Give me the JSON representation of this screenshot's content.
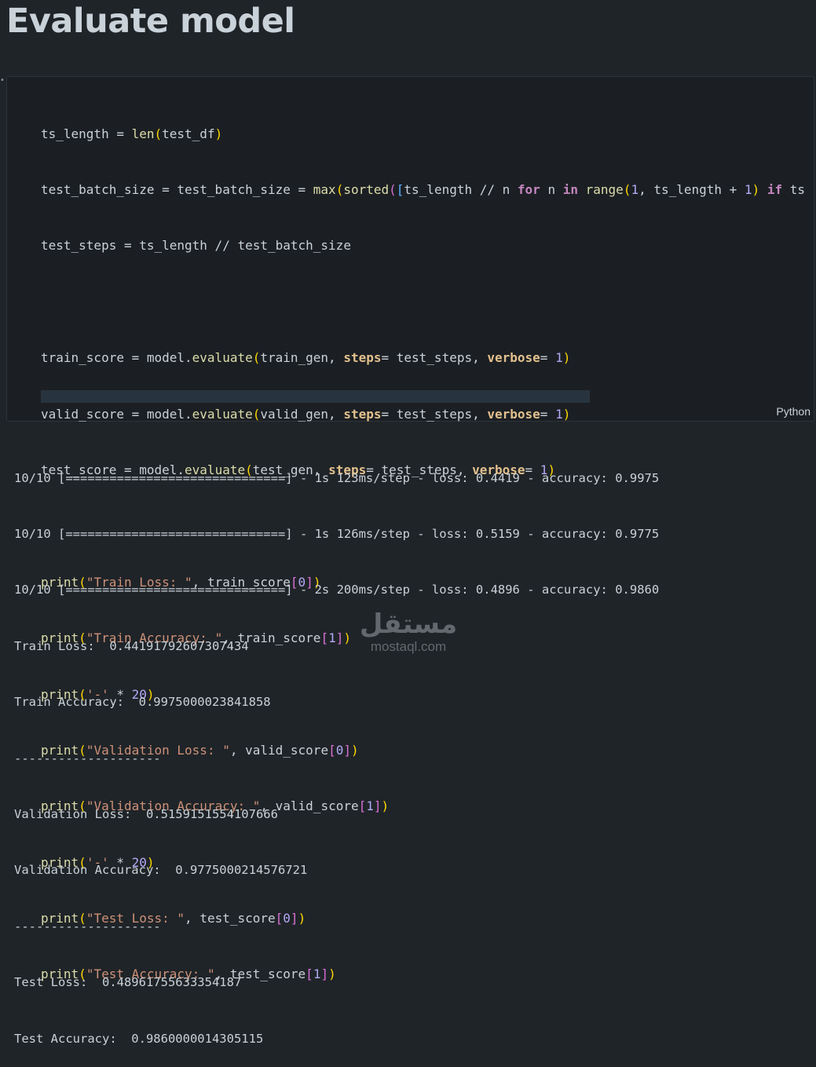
{
  "heading": "Evaluate model",
  "language_label": "Python",
  "code": {
    "l1": {
      "a": "ts_length = ",
      "b": "len",
      "c": "(",
      "d": "test_df",
      "e": ")"
    },
    "l2": {
      "a": "test_batch_size = test_batch_size = ",
      "b": "max",
      "c": "(",
      "d": "sorted",
      "e": "(",
      "f": "[",
      "g": "ts_length // n ",
      "h": "for",
      "i": " n ",
      "j": "in",
      "k": " ",
      "l": "range",
      "m": "(",
      "n": "1",
      ",": ", ts_length + ",
      "o": "1",
      "p": ")",
      "q": " ",
      "r": "if",
      "s": " ts"
    },
    "l3": {
      "a": "test_steps = ts_length // test_batch_size"
    },
    "l5": {
      "a": "train_score = model.",
      "b": "evaluate",
      "c": "(",
      "d": "train_gen, ",
      "e": "steps",
      "f": "= test_steps, ",
      "g": "verbose",
      "h": "= ",
      "i": "1",
      "j": ")"
    },
    "l6": {
      "a": "valid_score = model.",
      "b": "evaluate",
      "c": "(",
      "d": "valid_gen, ",
      "e": "steps",
      "f": "= test_steps, ",
      "g": "verbose",
      "h": "= ",
      "i": "1",
      "j": ")"
    },
    "l7": {
      "a": "test_score = model.",
      "b": "evaluate",
      "c": "(",
      "d": "test_gen, ",
      "e": "steps",
      "f": "= test_steps, ",
      "g": "verbose",
      "h": "= ",
      "i": "1",
      "j": ")"
    },
    "l9": {
      "a": "print",
      "b": "(",
      "c": "\"Train Loss: \"",
      "d": ", train_score",
      "e": "[",
      "f": "0",
      "g": "]",
      "h": ")"
    },
    "l10": {
      "a": "print",
      "b": "(",
      "c": "\"Train Accuracy: \"",
      "d": ", train_score",
      "e": "[",
      "f": "1",
      "g": "]",
      "h": ")"
    },
    "l11": {
      "a": "print",
      "b": "(",
      "c": "'-'",
      "d": " * ",
      "e": "20",
      "f": ")"
    },
    "l12": {
      "a": "print",
      "b": "(",
      "c": "\"Validation Loss: \"",
      "d": ", valid_score",
      "e": "[",
      "f": "0",
      "g": "]",
      "h": ")"
    },
    "l13": {
      "a": "print",
      "b": "(",
      "c": "\"Validation Accuracy: \"",
      "d": ", valid_score",
      "e": "[",
      "f": "1",
      "g": "]",
      "h": ")"
    },
    "l14": {
      "a": "print",
      "b": "(",
      "c": "'-'",
      "d": " * ",
      "e": "20",
      "f": ")"
    },
    "l15": {
      "a": "print",
      "b": "(",
      "c": "\"Test Loss: \"",
      "d": ", test_score",
      "e": "[",
      "f": "0",
      "g": "]",
      "h": ")"
    },
    "l16": {
      "a": "print",
      "b": "(",
      "c": "\"Test Accuracy: \"",
      "d": ", test_score",
      "e": "[",
      "f": "1",
      "g": "]",
      "h": ")"
    }
  },
  "output_lines": [
    "10/10 [==============================] - 1s 123ms/step - loss: 0.4419 - accuracy: 0.9975",
    "10/10 [==============================] - 1s 126ms/step - loss: 0.5159 - accuracy: 0.9775",
    "10/10 [==============================] - 2s 200ms/step - loss: 0.4896 - accuracy: 0.9860",
    "Train Loss:  0.44191792607307434",
    "Train Accuracy:  0.9975000023841858",
    "--------------------",
    "Validation Loss:  0.5159151554107666",
    "Validation Accuracy:  0.9775000214576721",
    "--------------------",
    "Test Loss:  0.48961755633354187",
    "Test Accuracy:  0.9860000014305115"
  ],
  "watermark": {
    "logo": "مستقل",
    "text": "mostaql.com"
  }
}
